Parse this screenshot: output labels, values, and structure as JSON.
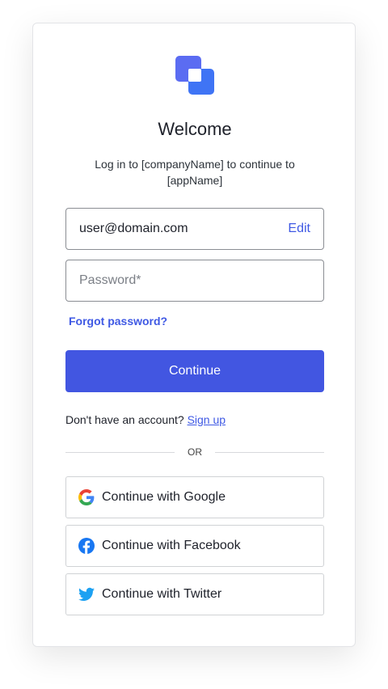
{
  "header": {
    "title": "Welcome",
    "subtitle": "Log in to [companyName] to continue to [appName]"
  },
  "form": {
    "email_value": "user@domain.com",
    "edit_label": "Edit",
    "password_placeholder": "Password*",
    "forgot_label": "Forgot password?",
    "continue_label": "Continue"
  },
  "signup": {
    "prompt": "Don't have an account?",
    "link": "Sign up"
  },
  "divider": {
    "label": "OR"
  },
  "social": {
    "google_label": "Continue with Google",
    "facebook_label": "Continue with Facebook",
    "twitter_label": "Continue with Twitter"
  },
  "colors": {
    "accent": "#4256e1",
    "link": "#3f59e4",
    "logo_back": "#5b6cf2",
    "logo_front": "#3f74f5",
    "facebook": "#1877f2",
    "twitter": "#1da1f2"
  },
  "icons": [
    "logo-icon",
    "google-icon",
    "facebook-icon",
    "twitter-icon"
  ]
}
